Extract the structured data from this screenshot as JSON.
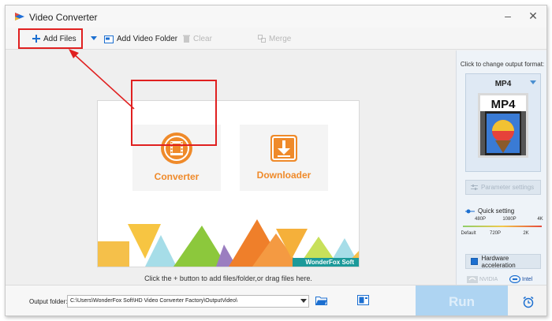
{
  "window": {
    "title": "Video Converter",
    "logo_icon": "app-logo-icon"
  },
  "toolbar": {
    "add_files": "Add Files",
    "add_video_folder": "Add Video Folder",
    "clear": "Clear",
    "merge": "Merge"
  },
  "main": {
    "modes": [
      {
        "label": "Converter",
        "icon": "film-icon"
      },
      {
        "label": "Downloader",
        "icon": "download-icon"
      }
    ],
    "brand": "WonderFox Soft",
    "hint": "Click the + button to add files/folder,or drag files here."
  },
  "right_panel": {
    "format_hint": "Click to change output format:",
    "format_name": "MP4",
    "thumb_label": "MP4",
    "parameter_settings": "Parameter settings",
    "quick_setting": "Quick setting",
    "quality_ticks_top": [
      "480P",
      "1080P",
      "4K"
    ],
    "quality_ticks_bottom": [
      "Default",
      "720P",
      "2K"
    ],
    "hardware_acceleration": "Hardware acceleration",
    "nvidia": "NVIDIA",
    "intel": "Intel"
  },
  "bottom": {
    "output_folder_label": "Output folder:",
    "output_path": "C:\\Users\\WonderFox Soft\\HD Video Converter Factory\\OutputVideo\\",
    "run": "Run"
  },
  "colors": {
    "accent": "#ef8a2a",
    "annotation_red": "#e02020",
    "run_button": "#aed4f2",
    "brand_teal": "#1c9a9a"
  }
}
